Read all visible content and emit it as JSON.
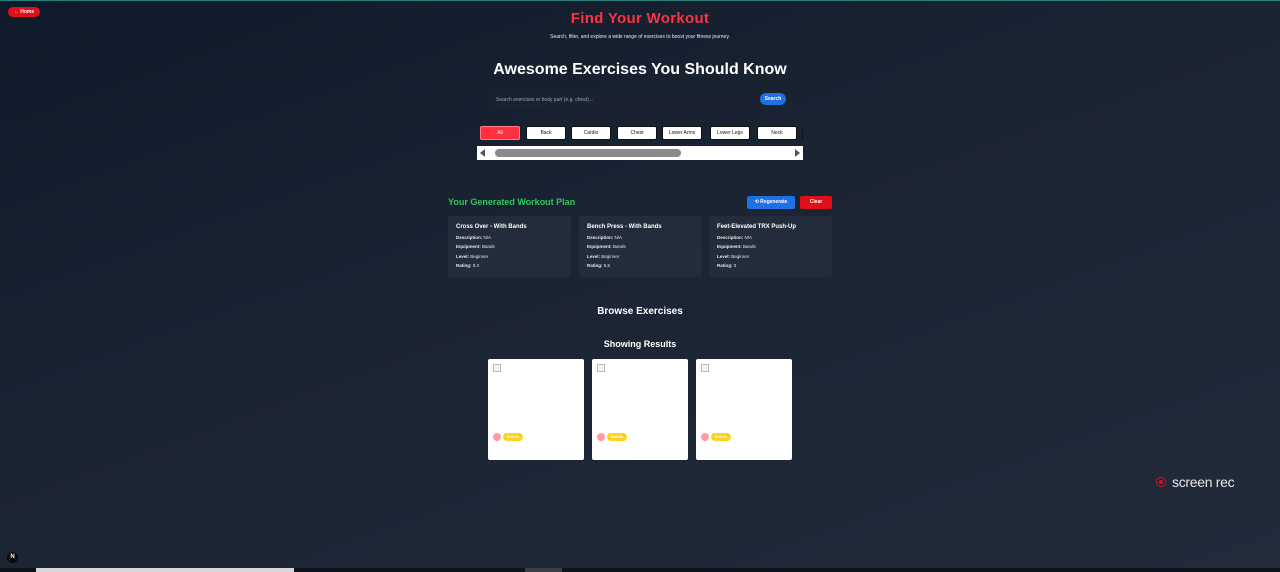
{
  "nav": {
    "home_label": "← Home"
  },
  "header": {
    "title": "Find Your Workout",
    "subtitle": "Search, filter, and explore a wide range of exercises to boost your fitness journey.",
    "heading": "Awesome Exercises You Should Know"
  },
  "search": {
    "placeholder": "Search exercises or body part (e.g. chest)...",
    "value": "",
    "button_label": "Search"
  },
  "filters": {
    "items": [
      "All",
      "Back",
      "Cardio",
      "Chest",
      "Lower Arms",
      "Lower Legs",
      "Neck"
    ],
    "active": "All"
  },
  "plan": {
    "title": "Your Generated Workout Plan",
    "regenerate_label": "⟲ Regenerate",
    "clear_label": "Clear",
    "field_labels": {
      "description": "Description:",
      "equipment": "Equipment:",
      "level": "Level:",
      "rating": "Rating:"
    },
    "cards": [
      {
        "name": "Cross Over - With Bands",
        "description": "N/A",
        "equipment": "Bands",
        "level": "Beginner",
        "rating": "8.3"
      },
      {
        "name": "Bench Press - With Bands",
        "description": "N/A",
        "equipment": "Bands",
        "level": "Beginner",
        "rating": "5.5"
      },
      {
        "name": "Feet-Elevated TRX Push-Up",
        "description": "N/A",
        "equipment": "Bands",
        "level": "Beginner",
        "rating": "0"
      }
    ]
  },
  "browse": {
    "title": "Browse Exercises",
    "results_title": "Showing Results"
  },
  "results": [
    {
      "badge": "Bands"
    },
    {
      "badge": "Bands"
    },
    {
      "badge": "Bands"
    }
  ],
  "overlay": {
    "screenrec_label": "screen rec",
    "n_badge": "N"
  },
  "colors": {
    "accent_red": "#ff3040",
    "accent_blue": "#1f6fe5",
    "plan_green": "#2fc85a",
    "badge_yellow": "#ffd21f"
  }
}
